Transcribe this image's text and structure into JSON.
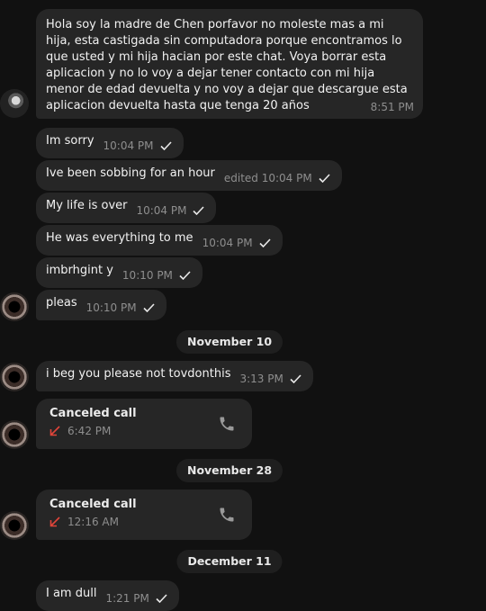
{
  "messages": [
    {
      "id": "m0",
      "text": "Hola soy la madre de Chen porfavor no moleste mas a mi hija, esta castigada sin computadora porque encontramos lo que usted y mi hija hacian por este chat. Voya borrar esta aplicacion y no lo voy a dejar tener contacto con mi hija menor de edad devuelta y no voy a dejar que descargue esta aplicacion devuelta hasta que tenga 20 años",
      "time": "8:51 PM"
    },
    {
      "id": "m1",
      "text": "Im sorry",
      "time": "10:04 PM"
    },
    {
      "id": "m2",
      "text": "Ive been sobbing for an hour",
      "time": "edited 10:04 PM"
    },
    {
      "id": "m3",
      "text": "My life is over",
      "time": "10:04 PM"
    },
    {
      "id": "m4",
      "text": "He was everything to me",
      "time": "10:04 PM"
    },
    {
      "id": "m5",
      "text": "imbrhgint y",
      "time": "10:10 PM"
    },
    {
      "id": "m6",
      "text": "pleas",
      "time": "10:10 PM"
    },
    {
      "id": "m7",
      "text": "i beg you please not tovdonthis",
      "time": "3:13 PM"
    },
    {
      "id": "c1",
      "title": "Canceled call",
      "time": "6:42 PM"
    },
    {
      "id": "c2",
      "title": "Canceled call",
      "time": "12:16 AM"
    },
    {
      "id": "m8",
      "text": "I am dull",
      "time": "1:21 PM"
    }
  ],
  "dates": {
    "nov10": "November 10",
    "nov28": "November 28",
    "dec11": "December 11"
  },
  "icons": {
    "check": "checkmark-icon",
    "phone": "phone-icon",
    "missed_arrow": "call-arrow-icon"
  },
  "colors": {
    "background": "#111111",
    "bubble": "#262626",
    "meta_text": "#8e8e8e",
    "missed_call_red": "#e0453a"
  }
}
